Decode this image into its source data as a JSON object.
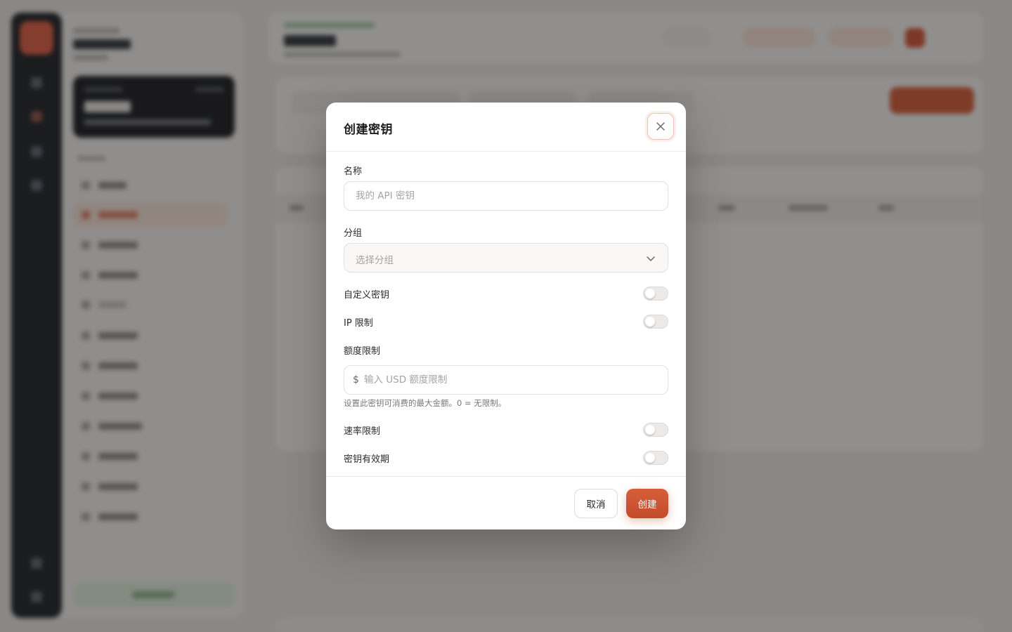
{
  "modal": {
    "title": "创建密钥",
    "close_icon": "close-icon",
    "fields": {
      "name": {
        "label": "名称",
        "placeholder": "我的 API 密钥",
        "value": ""
      },
      "group": {
        "label": "分组",
        "placeholder": "选择分组",
        "icon": "chevron-down-icon"
      },
      "custom_key": {
        "label": "自定义密钥",
        "enabled": false
      },
      "ip_limit": {
        "label": "IP 限制",
        "enabled": false
      },
      "quota": {
        "label": "额度限制",
        "currency_symbol": "$",
        "placeholder": "输入 USD 额度限制",
        "hint": "设置此密钥可消费的最大金额。0 = 无限制。"
      },
      "rate_limit": {
        "label": "速率限制",
        "enabled": false
      },
      "expiry": {
        "label": "密钥有效期",
        "enabled": false
      }
    },
    "buttons": {
      "cancel": "取消",
      "create": "创建"
    }
  },
  "colors": {
    "accent": "#d0552f",
    "overlay": "#222222",
    "sidebar_dark": "#15171c"
  }
}
